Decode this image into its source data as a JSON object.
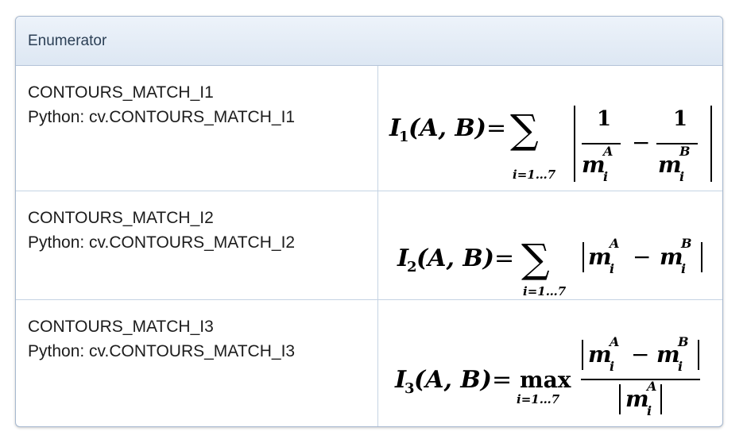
{
  "table": {
    "header": "Enumerator",
    "rows": [
      {
        "enum_name": "CONTOURS_MATCH_I1",
        "python_name": "Python: cv.CONTOURS_MATCH_I1",
        "formula": "I1(A,B) = sum_{i=1...7} |1/m_i^A - 1/m_i^B|"
      },
      {
        "enum_name": "CONTOURS_MATCH_I2",
        "python_name": "Python: cv.CONTOURS_MATCH_I2",
        "formula": "I2(A,B) = sum_{i=1...7} |m_i^A - m_i^B|"
      },
      {
        "enum_name": "CONTOURS_MATCH_I3",
        "python_name": "Python: cv.CONTOURS_MATCH_I3",
        "formula": "I3(A,B) = max_{i=1...7} |m_i^A - m_i^B| / |m_i^A|"
      }
    ]
  },
  "math": {
    "I": "I",
    "sub1": "1",
    "sub2": "2",
    "sub3": "3",
    "args": "(A, B)",
    "eq": "=",
    "sum": "∑",
    "max": "max",
    "range": "i=1…7",
    "one": "1",
    "minus": "−",
    "m": "m",
    "i": "i",
    "A": "A",
    "B": "B"
  }
}
